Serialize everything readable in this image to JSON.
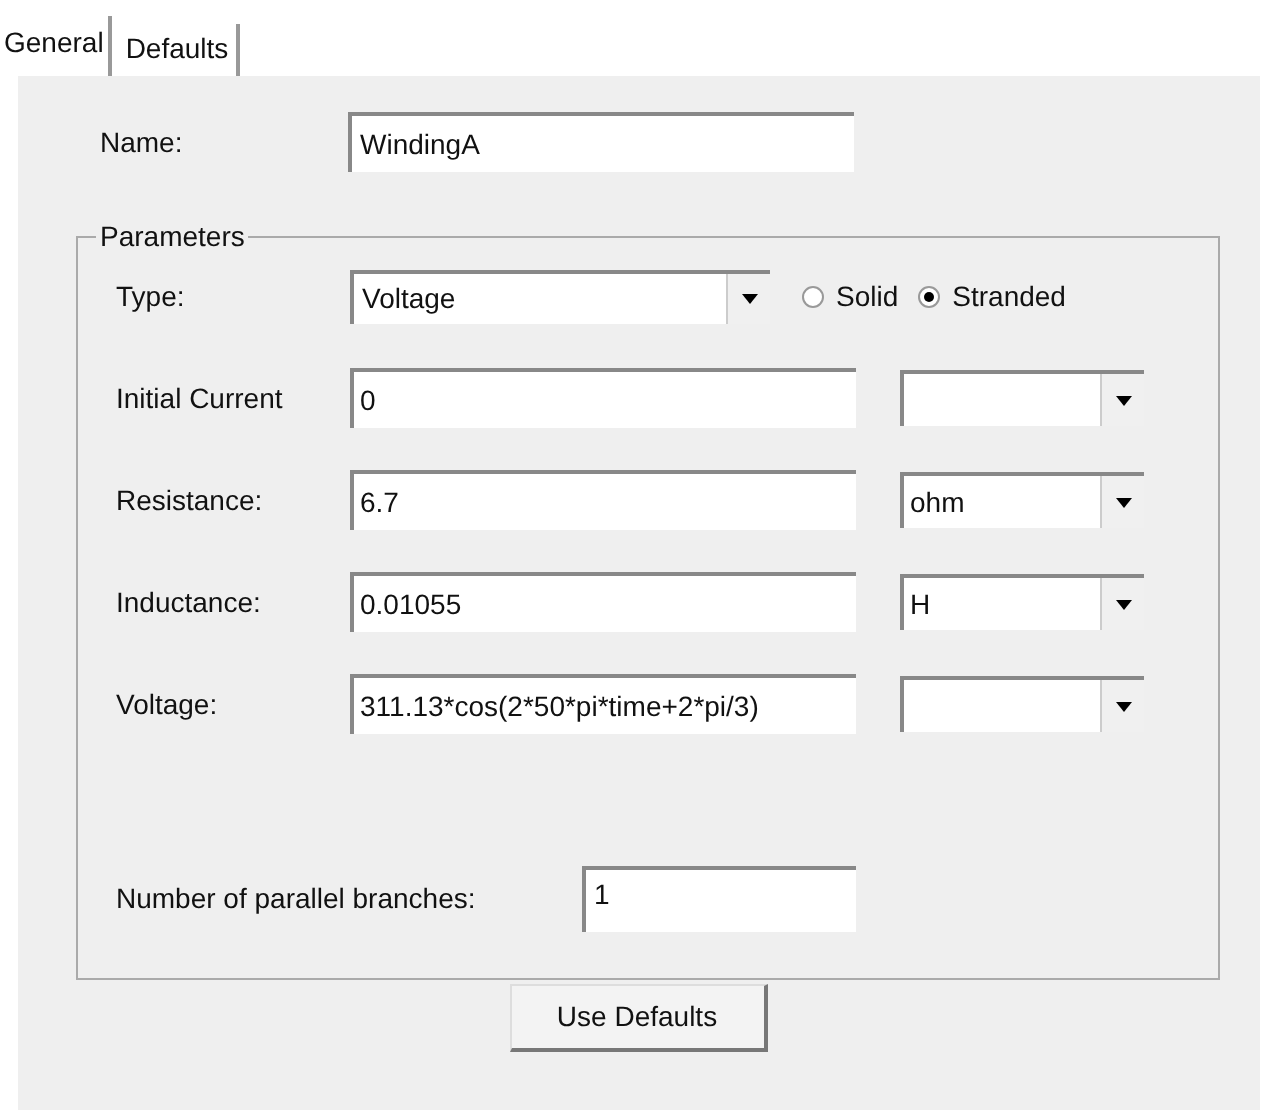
{
  "tabs": [
    {
      "label": "General",
      "selected": true
    },
    {
      "label": "Defaults",
      "selected": false
    }
  ],
  "name": {
    "label": "Name:",
    "value": "WindingA"
  },
  "parameters": {
    "legend": "Parameters",
    "type": {
      "label": "Type:",
      "value": "Voltage",
      "options": [
        {
          "label": "Solid",
          "selected": false
        },
        {
          "label": "Stranded",
          "selected": true
        }
      ]
    },
    "rows": [
      {
        "label": "Initial Current",
        "value": "0",
        "unit": ""
      },
      {
        "label": "Resistance:",
        "value": "6.7",
        "unit": "ohm"
      },
      {
        "label": "Inductance:",
        "value": "0.01055",
        "unit": "H"
      },
      {
        "label": "Voltage:",
        "value": "311.13*cos(2*50*pi*time+2*pi/3)",
        "unit": ""
      }
    ],
    "branches": {
      "label": "Number of parallel branches:",
      "value": "1"
    }
  },
  "button": "Use Defaults"
}
